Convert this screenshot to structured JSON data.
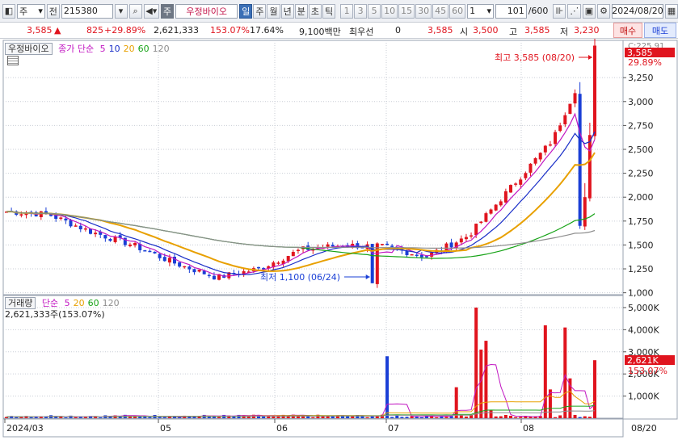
{
  "toolbar": {
    "market": "주",
    "prev_label": "전",
    "code": "215380",
    "code_tag": "주",
    "stock_name": "우정바이오",
    "periods": [
      "일",
      "주",
      "월",
      "년",
      "분",
      "초",
      "틱"
    ],
    "selected_period": "일",
    "minute_options": [
      "1",
      "3",
      "5",
      "10",
      "15",
      "30",
      "45",
      "60"
    ],
    "interval_value": "1",
    "count": "101",
    "count_total": "/600",
    "date": "2024/08/20"
  },
  "quote": {
    "price": "3,585",
    "arrow": "▲",
    "change": "825",
    "change_pct": "+29.89%",
    "volume": "2,621,333",
    "volume_ratio": "153.07%",
    "turnover": "17.64%",
    "amount": "9,100백만",
    "preferred_label": "최우선",
    "preferred_value": "0",
    "best_price": "3,585",
    "open_label": "시",
    "open": "3,500",
    "high_label": "고",
    "high": "3,585",
    "low_label": "저",
    "low": "3,230",
    "buy_label": "매수",
    "sell_label": "매도"
  },
  "price_panel": {
    "name_label": "우정바이오",
    "ma_label": "종가 단순",
    "ma_periods": [
      "5",
      "10",
      "20",
      "60",
      "120"
    ],
    "ma_colors": [
      "#c218c2",
      "#1a2fc8",
      "#e8a000",
      "#17a317",
      "#8d8d8d"
    ],
    "high_note": "최고 3,585 (08/20)",
    "low_note": "최저 1,100 (06/24)",
    "axis_top_partial": "C:225.91",
    "last_price_tag": "3,585",
    "last_pct_tag": "29.89%",
    "y_ticks": [
      "3,250",
      "3,000",
      "2,750",
      "2,500",
      "2,250",
      "2,000",
      "1,750",
      "1,500",
      "1,250",
      "1,000"
    ]
  },
  "volume_panel": {
    "label": "거래량",
    "ma_label": "단순",
    "ma_periods": [
      "5",
      "20",
      "60",
      "120"
    ],
    "ma_colors": [
      "#c218c2",
      "#e8a000",
      "#17a317",
      "#8d8d8d"
    ],
    "value_text": "2,621,333주(153.07%)",
    "y_ticks": [
      "5,000K",
      "4,000K",
      "3,000K",
      "2,000K",
      "1,000K"
    ],
    "last_tag": "2,621K",
    "last_pct_tag": "153.07%"
  },
  "x_axis": {
    "labels": [
      "2024/03",
      "05",
      "06",
      "07",
      "08"
    ],
    "right_label": "08/20"
  },
  "chart_data": {
    "type": "candlestick",
    "x": [
      "2024/03",
      "05",
      "06",
      "07",
      "08",
      "08/20"
    ],
    "price_series": {
      "name": "우정바이오",
      "approx_close": [
        1850,
        1820,
        1640,
        1500,
        1310,
        1160,
        1250,
        1450,
        1500,
        1480,
        1380,
        1600,
        2100,
        2600,
        3585
      ],
      "high": 3585,
      "high_date": "08/20",
      "low": 1100,
      "low_date": "06/24"
    },
    "volume_series": {
      "name": "거래량",
      "last": 2621333,
      "spikes_k": [
        2800,
        2500,
        5000,
        3500,
        4200,
        4100,
        2621
      ]
    },
    "ylim_price": [
      1000,
      3585
    ],
    "ylim_volume": [
      0,
      5000000
    ]
  }
}
